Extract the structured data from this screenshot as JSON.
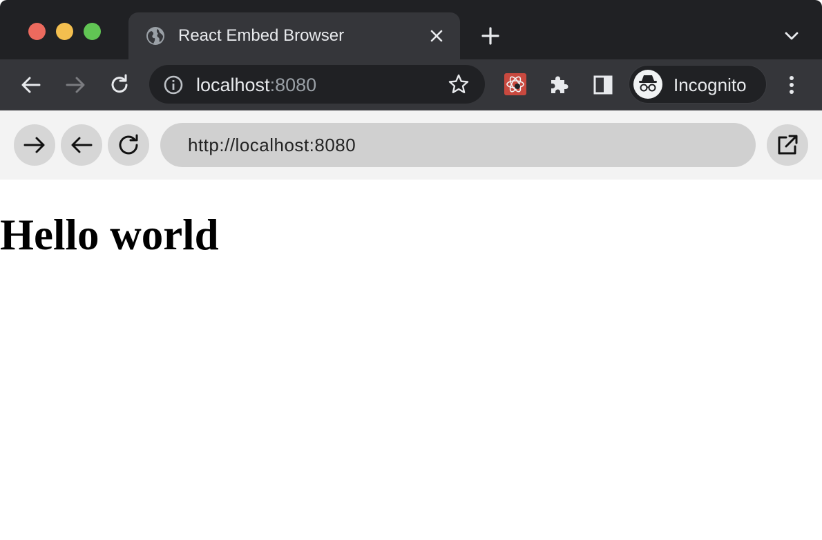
{
  "window": {
    "controls": [
      "close",
      "minimize",
      "zoom"
    ]
  },
  "tab": {
    "title": "React Embed Browser",
    "favicon": "globe-icon"
  },
  "toolbar": {
    "address_host": "localhost",
    "address_port": ":8080",
    "profile_label": "Incognito",
    "extension_icon": "react-devtools-icon"
  },
  "embed": {
    "url_value": "http://localhost:8080",
    "buttons": [
      "forward-arrow-icon",
      "back-arrow-icon",
      "reload-icon",
      "open-external-icon"
    ]
  },
  "page": {
    "heading": "Hello world"
  },
  "colors": {
    "titlebar": "#202124",
    "toolbar": "#35363a",
    "embed_bar": "#f3f3f3",
    "url_field": "#d0d0d0",
    "circle_button": "#d6d6d6"
  }
}
